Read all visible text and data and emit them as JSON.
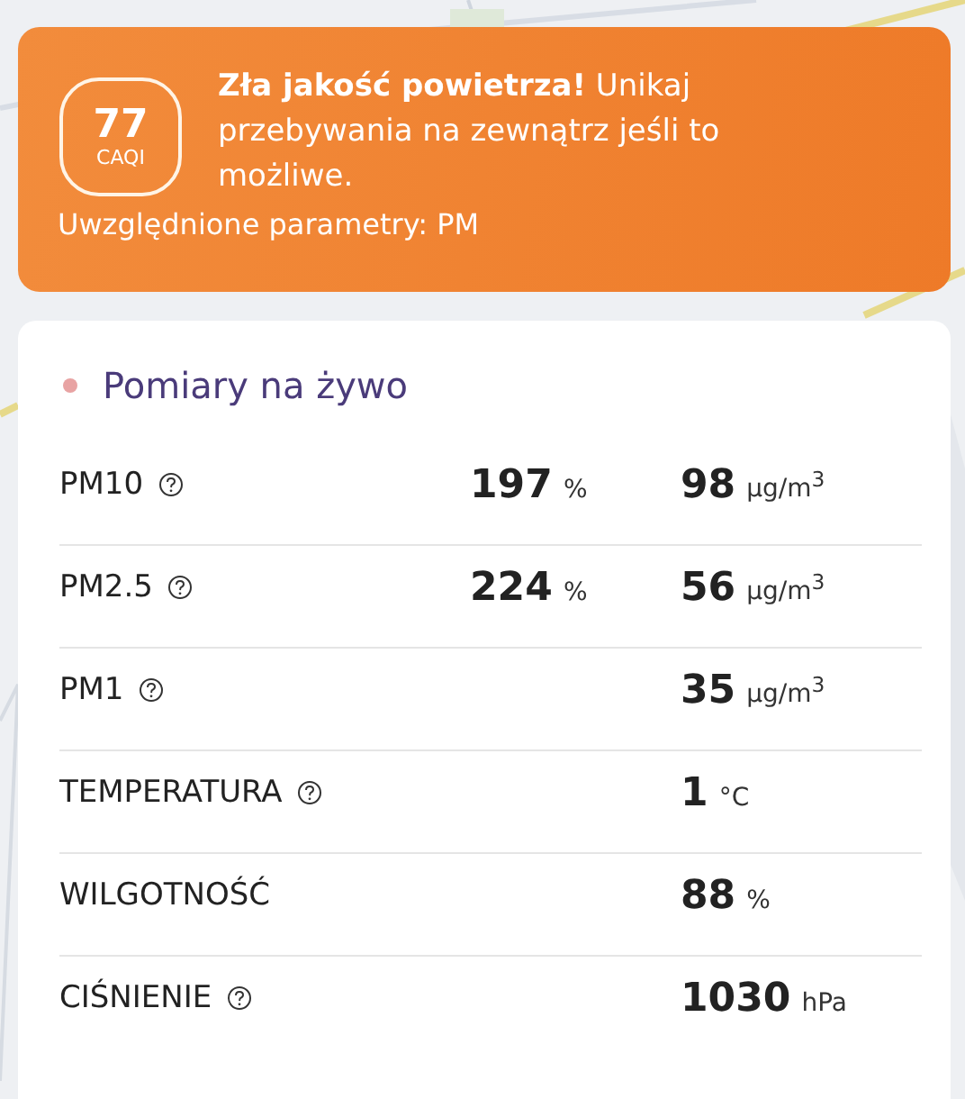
{
  "alert": {
    "index_value": "77",
    "index_unit": "CAQI",
    "message": "**Zła jakość powietrza!** Unikaj przebywania na zewnątrz jeśli to możliwe.",
    "parameters": "Uwzględnione parametry: PM"
  },
  "measurements": {
    "title": "Pomiary na żywo",
    "rows": [
      {
        "label": "PM10",
        "help": true,
        "percent": "197",
        "percent_unit": "%",
        "value": "98",
        "unit": "µg/m$^{3}$"
      },
      {
        "label": "PM2.5",
        "help": true,
        "percent": "224",
        "percent_unit": "%",
        "value": "56",
        "unit": "µg/m$^{3}$"
      },
      {
        "label": "PM1",
        "help": true,
        "value": "35",
        "unit": "µg/m$^{3}$"
      },
      {
        "label": "TEMPERATURA",
        "help": true,
        "value": "1",
        "unit": "°C"
      },
      {
        "label": "WILGOTNOŚĆ",
        "help": false,
        "value": "88",
        "unit": "%"
      },
      {
        "label": "CIŚNIENIE",
        "help": true,
        "value": "1030",
        "unit": "hPa"
      }
    ]
  }
}
